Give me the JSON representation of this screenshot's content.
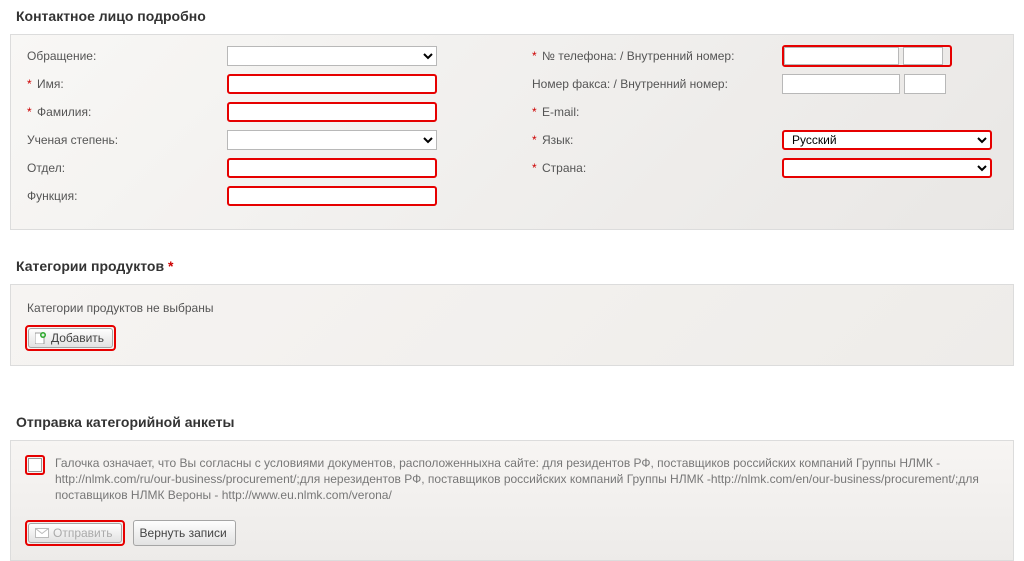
{
  "sections": {
    "contact_header": "Контактное лицо подробно",
    "categories_header": "Категории продуктов",
    "submission_header": "Отправка категорийной анкеты"
  },
  "labels": {
    "salutation": "Обращение:",
    "first_name": "Имя:",
    "last_name": "Фамилия:",
    "degree": "Ученая степень:",
    "department": "Отдел:",
    "function": "Функция:",
    "phone": "№ телефона:  / Внутренний номер:",
    "fax": "Номер факса:  / Внутренний номер:",
    "email": "E-mail:",
    "language": "Язык:",
    "country": "Страна:"
  },
  "values": {
    "salutation": "",
    "first_name": "",
    "last_name": "",
    "degree": "",
    "department": "",
    "function": "",
    "phone": "",
    "phone_ext": "",
    "fax": "",
    "fax_ext": "",
    "email": "",
    "language": "Русский",
    "country": ""
  },
  "categories": {
    "empty_text": "Категории продуктов не выбраны",
    "add_button": "Добавить"
  },
  "submission": {
    "consent_text": "Галочка означает, что Вы согласны с условиями документов, расположенныхна сайте: для резидентов РФ, поставщиков российских компаний Группы НЛМК -http://nlmk.com/ru/our-business/procurement/;для нерезидентов РФ, поставщиков российских компаний Группы НЛМК -http://nlmk.com/en/our-business/procurement/;для поставщиков НЛМК Вероны - http://www.eu.nlmk.com/verona/",
    "send_button": "Отправить",
    "revert_button": "Вернуть записи"
  },
  "asterisk": "*"
}
